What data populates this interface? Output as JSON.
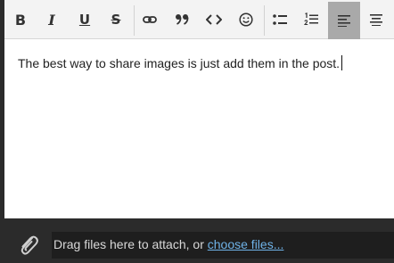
{
  "toolbar": {
    "buttons": [
      {
        "name": "bold",
        "icon": "bold-icon",
        "label": "B"
      },
      {
        "name": "italic",
        "icon": "italic-icon",
        "label": "I"
      },
      {
        "name": "underline",
        "icon": "underline-icon",
        "label": "U"
      },
      {
        "name": "strikethrough",
        "icon": "strikethrough-icon",
        "label": "S"
      },
      {
        "name": "link",
        "icon": "link-icon"
      },
      {
        "name": "quote",
        "icon": "quote-icon",
        "label": "”"
      },
      {
        "name": "code",
        "icon": "code-icon",
        "label": "<>"
      },
      {
        "name": "emoji",
        "icon": "smiley-icon"
      },
      {
        "name": "bullet-list",
        "icon": "bullet-list-icon"
      },
      {
        "name": "numbered-list",
        "icon": "numbered-list-icon"
      },
      {
        "name": "align-left",
        "icon": "align-left-icon",
        "active": true
      },
      {
        "name": "align-center",
        "icon": "align-center-icon"
      }
    ]
  },
  "editor": {
    "content": "The best way to share images is just add them in the post."
  },
  "attach": {
    "text": "Drag files here to attach, or ",
    "link": "choose files..."
  },
  "colors": {
    "toolbar_bg": "#f3f3f3",
    "active_button_bg": "#a9a9a9",
    "attach_bg": "#2b2b2b",
    "link": "#6fb3e8"
  }
}
